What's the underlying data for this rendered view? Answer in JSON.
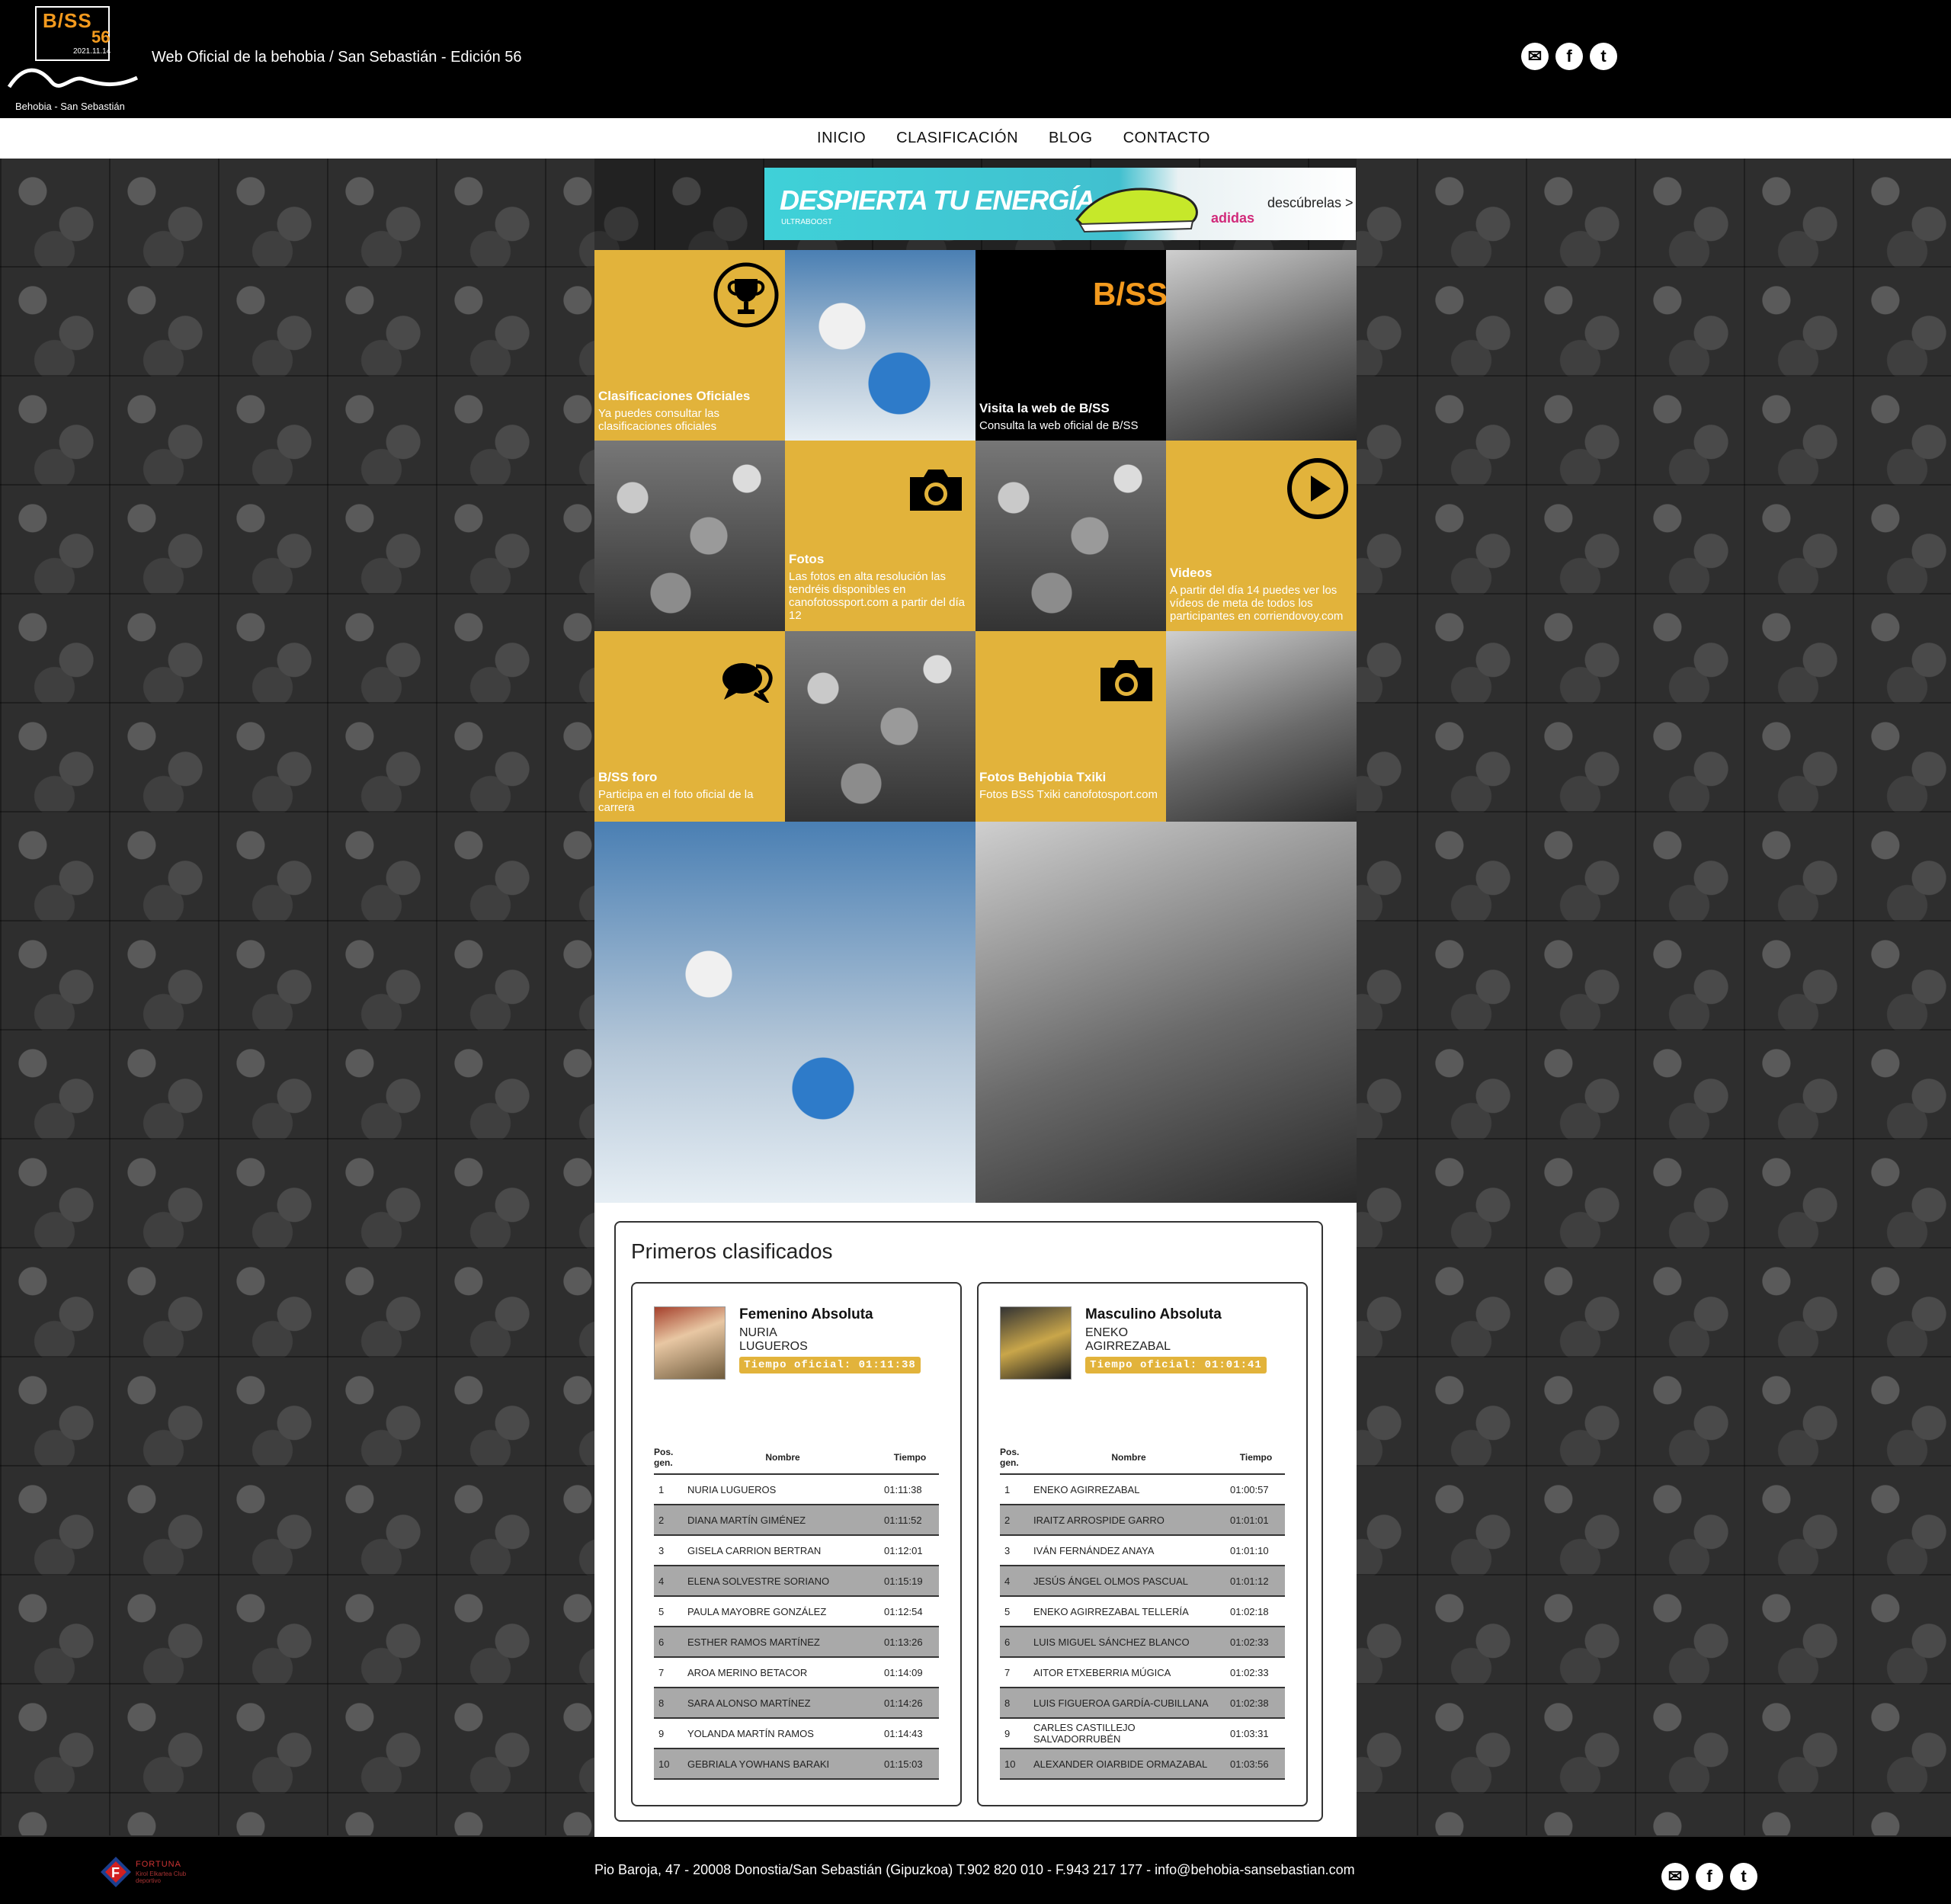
{
  "header": {
    "logo_brand": "B/SS",
    "logo_edition_num": "56",
    "logo_date": "2021.11.14",
    "logo_tagline": "Behobia - San Sebastián",
    "site_title": "Web Oficial de la behobia / San Sebastián - Edición 56",
    "social": [
      {
        "icon": "chat-icon",
        "glyph": "✉"
      },
      {
        "icon": "facebook-icon",
        "glyph": "f"
      },
      {
        "icon": "twitter-icon",
        "glyph": "t"
      }
    ]
  },
  "nav": {
    "items": [
      "INICIO",
      "CLASIFICACIÓN",
      "BLOG",
      "CONTACTO"
    ]
  },
  "banner": {
    "headline": "DESPIERTA TU ENERGÍA",
    "sub": "ULTRABOOST",
    "brand": "adidas",
    "cta": "descúbrelas >"
  },
  "tiles": {
    "clasificaciones": {
      "title": "Clasificaciones Oficiales",
      "desc": "Ya puedes consultar las clasificaciones oficiales",
      "icon": "trophy-icon"
    },
    "bss_web": {
      "logo": "B/SS",
      "title": "Visita la web de B/SS",
      "desc": "Consulta la web oficial de B/SS"
    },
    "fotos": {
      "title": "Fotos",
      "desc": "Las fotos en alta resolución las tendréis disponibles en canofotossport.com a partir del día 12",
      "icon": "camera-icon"
    },
    "videos": {
      "title": "Videos",
      "desc": "A partir del día 14 puedes ver los vídeos de meta de todos los participantes en corriendovoy.com",
      "icon": "play-icon"
    },
    "foro": {
      "title": "B/SS foro",
      "desc": "Participa en el foto oficial de la carrera",
      "icon": "chat-bubbles-icon"
    },
    "txiki": {
      "title": "Fotos Behjobia Txiki",
      "desc": "Fotos BSS Txiki canofotosport.com",
      "icon": "camera-icon"
    }
  },
  "results": {
    "title": "Primeros clasificados",
    "columns": {
      "pos": "Pos. gen.",
      "name": "Nombre",
      "time": "Tiempo"
    },
    "female": {
      "category": "Femenino Absoluta",
      "winner_first": "NURIA",
      "winner_last": "LUGUEROS",
      "official_time": "Tiempo oficial: 01:11:38",
      "rows": [
        {
          "pos": "1",
          "name": "NURIA LUGUEROS",
          "time": "01:11:38"
        },
        {
          "pos": "2",
          "name": "DIANA MARTÍN GIMÉNEZ",
          "time": "01:11:52"
        },
        {
          "pos": "3",
          "name": "GISELA CARRION BERTRAN",
          "time": "01:12:01"
        },
        {
          "pos": "4",
          "name": "ELENA SOLVESTRE SORIANO",
          "time": "01:15:19"
        },
        {
          "pos": "5",
          "name": "PAULA MAYOBRE GONZÁLEZ",
          "time": "01:12:54"
        },
        {
          "pos": "6",
          "name": "ESTHER RAMOS MARTÍNEZ",
          "time": "01:13:26"
        },
        {
          "pos": "7",
          "name": "AROA MERINO BETACOR",
          "time": "01:14:09"
        },
        {
          "pos": "8",
          "name": "SARA ALONSO MARTÍNEZ",
          "time": "01:14:26"
        },
        {
          "pos": "9",
          "name": "YOLANDA MARTÍN RAMOS",
          "time": "01:14:43"
        },
        {
          "pos": "10",
          "name": "GEBRIALA YOWHANS BARAKI",
          "time": "01:15:03"
        }
      ]
    },
    "male": {
      "category": "Masculino Absoluta",
      "winner_first": "ENEKO",
      "winner_last": "AGIRREZABAL",
      "official_time": "Tiempo oficial: 01:01:41",
      "rows": [
        {
          "pos": "1",
          "name": "ENEKO AGIRREZABAL",
          "time": "01:00:57"
        },
        {
          "pos": "2",
          "name": "IRAITZ ARROSPIDE GARRO",
          "time": "01:01:01"
        },
        {
          "pos": "3",
          "name": "IVÁN FERNÁNDEZ ANAYA",
          "time": "01:01:10"
        },
        {
          "pos": "4",
          "name": "JESÚS ÁNGEL OLMOS PASCUAL",
          "time": "01:01:12"
        },
        {
          "pos": "5",
          "name": "ENEKO AGIRREZABAL TELLERÍA",
          "time": "01:02:18"
        },
        {
          "pos": "6",
          "name": "LUIS MIGUEL SÁNCHEZ BLANCO",
          "time": "01:02:33"
        },
        {
          "pos": "7",
          "name": "AITOR ETXEBERRIA MÚGICA",
          "time": "01:02:33"
        },
        {
          "pos": "8",
          "name": "LUIS FIGUEROA GARDÍA-CUBILLANA",
          "time": "01:02:38"
        },
        {
          "pos": "9",
          "name": "CARLES CASTILLEJO SALVADORRUBÉN",
          "time": "01:03:31"
        },
        {
          "pos": "10",
          "name": "ALEXANDER OIARBIDE ORMAZABAL",
          "time": "01:03:56"
        }
      ]
    }
  },
  "footer": {
    "club_name": "FORTUNA",
    "club_sub": "Kirol Elkartea Club deportivo",
    "address": "Pio Baroja, 47 - 20008 Donostia/San Sebastián (Gipuzkoa) T.902 820 010 - F.943 217 177 - info@behobia-sansebastian.com"
  },
  "colors": {
    "accent": "#e2b33b",
    "logo_orange": "#f39a1e",
    "background": "#000000"
  }
}
